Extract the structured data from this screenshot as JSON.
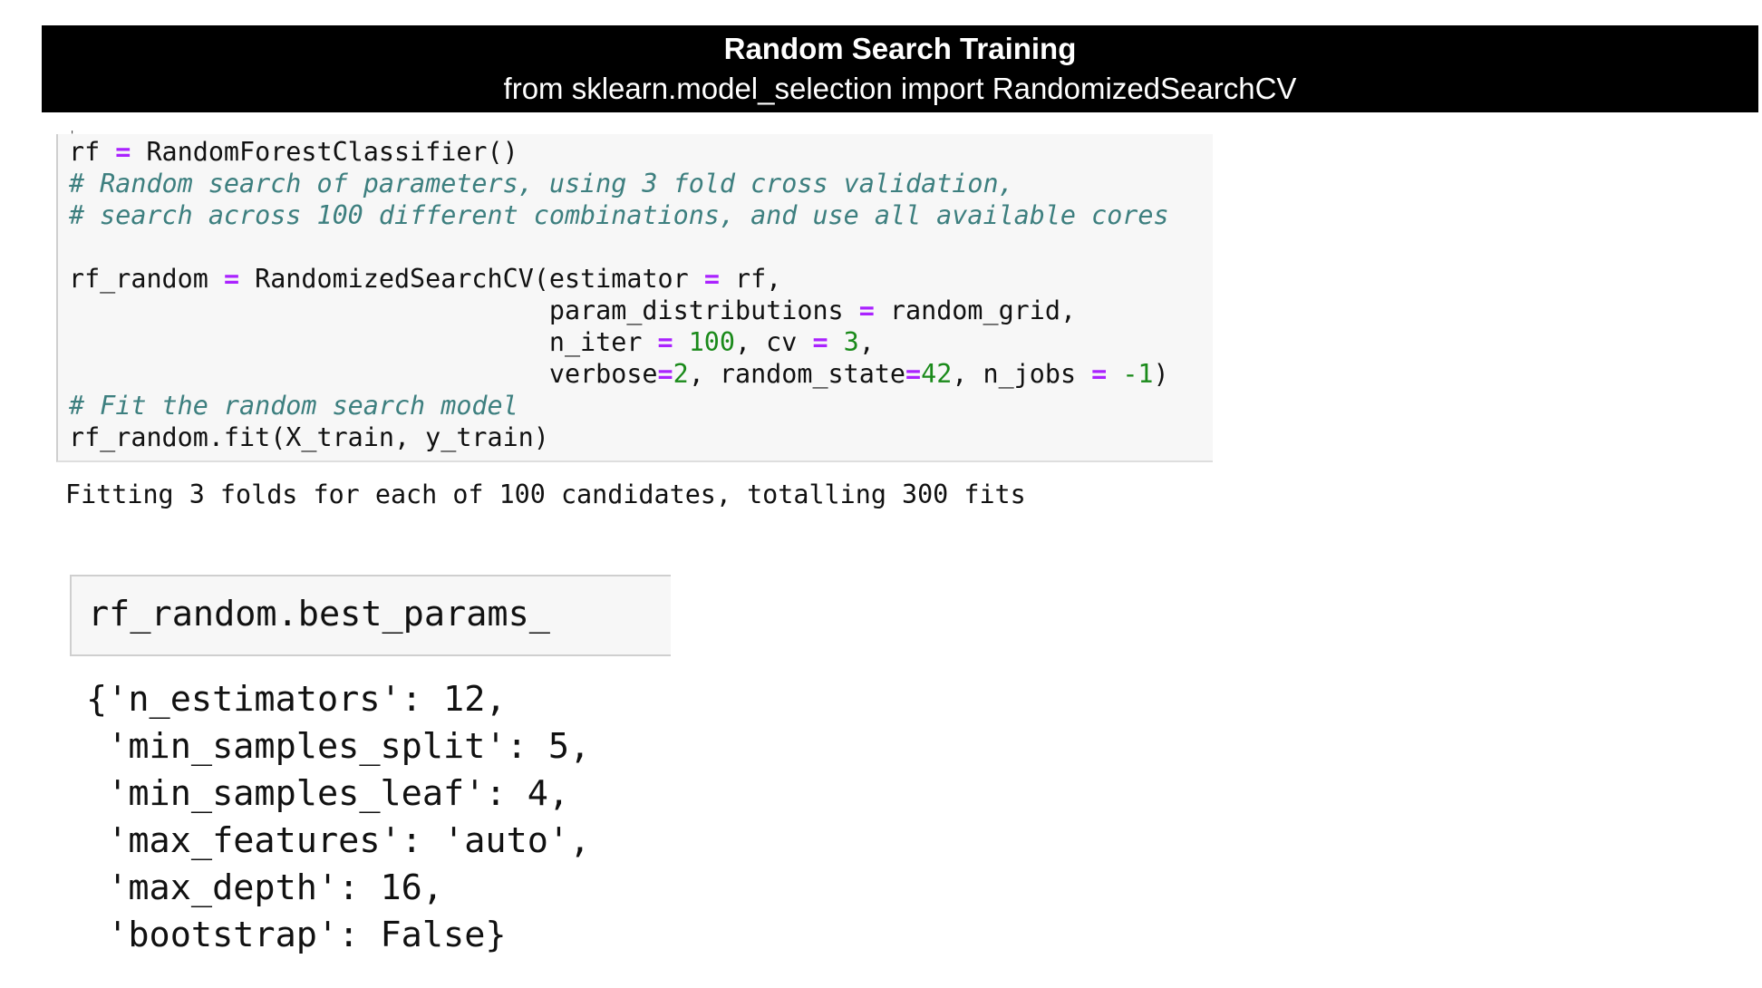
{
  "banner": {
    "title": "Random Search Training",
    "subtitle": "from sklearn.model_selection import RandomizedSearchCV"
  },
  "cell1": {
    "tick": "'",
    "lines": [
      [
        {
          "t": "rf "
        },
        {
          "t": "=",
          "c": "op"
        },
        {
          "t": " RandomForestClassifier()"
        }
      ],
      [
        {
          "t": "# Random search of parameters, using 3 fold cross validation,",
          "c": "cm"
        }
      ],
      [
        {
          "t": "# search across 100 different combinations, and use all available cores",
          "c": "cm"
        }
      ],
      [
        {
          "t": ""
        }
      ],
      [
        {
          "t": "rf_random "
        },
        {
          "t": "=",
          "c": "op"
        },
        {
          "t": " RandomizedSearchCV(estimator "
        },
        {
          "t": "=",
          "c": "op"
        },
        {
          "t": " rf,"
        }
      ],
      [
        {
          "t": "                               param_distributions "
        },
        {
          "t": "=",
          "c": "op"
        },
        {
          "t": " random_grid,"
        }
      ],
      [
        {
          "t": "                               n_iter "
        },
        {
          "t": "=",
          "c": "op"
        },
        {
          "t": " "
        },
        {
          "t": "100",
          "c": "num"
        },
        {
          "t": ", cv "
        },
        {
          "t": "=",
          "c": "op"
        },
        {
          "t": " "
        },
        {
          "t": "3",
          "c": "num"
        },
        {
          "t": ","
        }
      ],
      [
        {
          "t": "                               verbose"
        },
        {
          "t": "=",
          "c": "op"
        },
        {
          "t": "2",
          "c": "num"
        },
        {
          "t": ", random_state"
        },
        {
          "t": "=",
          "c": "op"
        },
        {
          "t": "42",
          "c": "num"
        },
        {
          "t": ", n_jobs "
        },
        {
          "t": "=",
          "c": "op"
        },
        {
          "t": " "
        },
        {
          "t": "-1",
          "c": "num"
        },
        {
          "t": ")"
        }
      ],
      [
        {
          "t": "# Fit the random search model",
          "c": "cm"
        }
      ],
      [
        {
          "t": "rf_random.fit(X_train, y_train)"
        }
      ]
    ]
  },
  "output1": "Fitting 3 folds for each of 100 candidates, totalling 300 fits",
  "cell2": {
    "code": "rf_random.best_params_"
  },
  "output2": {
    "lines": [
      "{'n_estimators': 12,",
      " 'min_samples_split': 5,",
      " 'min_samples_leaf': 4,",
      " 'max_features': 'auto',",
      " 'max_depth': 16,",
      " 'bootstrap': False}"
    ]
  },
  "colors": {
    "banner_bg": "#000000",
    "banner_text": "#ffffff",
    "comment": "#3d7f7f",
    "operator": "#aa22ff",
    "number": "#1a8a1a",
    "cell_bg": "#f7f7f7"
  }
}
